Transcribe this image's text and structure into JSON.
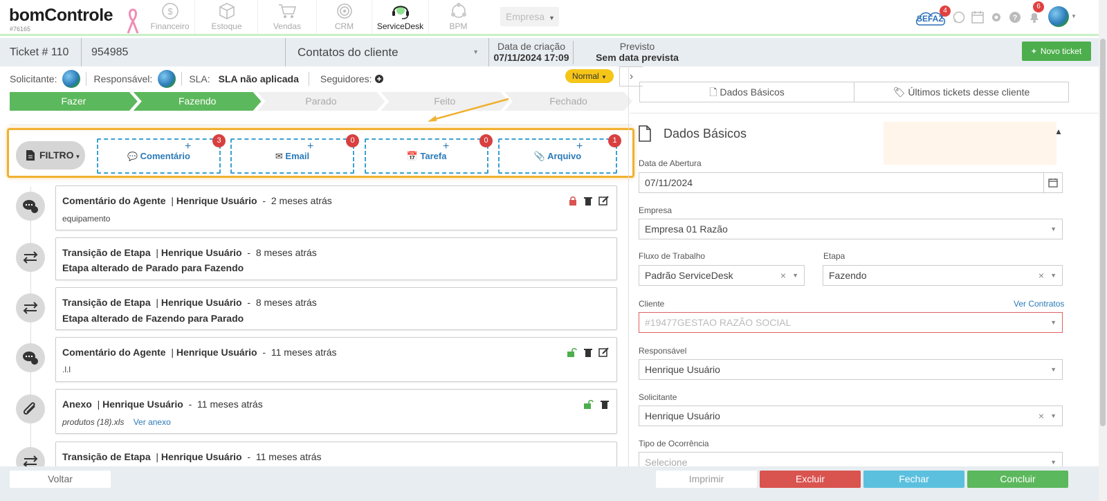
{
  "app": {
    "logo": "bomControle",
    "account_id": "#76165"
  },
  "nav": [
    {
      "label": "Financeiro",
      "icon": "dollar-icon",
      "active": false
    },
    {
      "label": "Estoque",
      "icon": "box-icon",
      "active": false
    },
    {
      "label": "Vendas",
      "icon": "cart-icon",
      "active": false
    },
    {
      "label": "CRM",
      "icon": "target-icon",
      "active": false
    },
    {
      "label": "ServiceDesk",
      "icon": "headset-icon",
      "active": true
    },
    {
      "label": "BPM",
      "icon": "network-icon",
      "active": false
    }
  ],
  "empresa_select": "Empresa",
  "topright": {
    "sefaz_label": "SEFAZ",
    "sefaz_count": "4",
    "notif_count": "6"
  },
  "ticket": {
    "number": "Ticket # 110",
    "code": "954985",
    "contacts_select": "Contatos do cliente",
    "created_label": "Data de criação",
    "created_value": "07/11/2024 17:09",
    "forecast_label": "Previsto",
    "forecast_value": "Sem data prevista",
    "new_ticket": "Novo ticket"
  },
  "info": {
    "requester_label": "Solicitante:",
    "responsible_label": "Responsável:",
    "sla_label": "SLA:",
    "sla_value": "SLA não aplicada",
    "followers_label": "Seguidores:",
    "priority": "Normal"
  },
  "stages": [
    {
      "label": "Fazer",
      "done": true
    },
    {
      "label": "Fazendo",
      "done": true
    },
    {
      "label": "Parado",
      "done": false
    },
    {
      "label": "Feito",
      "done": false
    },
    {
      "label": "Fechado",
      "done": false
    }
  ],
  "filter": {
    "label": "FILTRO",
    "actions": [
      {
        "label": "Comentário",
        "count": "3"
      },
      {
        "label": "Email",
        "count": "0"
      },
      {
        "label": "Tarefa",
        "count": "0"
      },
      {
        "label": "Arquivo",
        "count": "1"
      }
    ]
  },
  "timeline": [
    {
      "type": "Comentário do Agente",
      "user": "Henrique Usuário",
      "when": "2 meses atrás",
      "body": "equipamento",
      "bold_body": false
    },
    {
      "type": "Transição de Etapa",
      "user": "Henrique Usuário",
      "when": "8 meses atrás",
      "body": "Etapa alterado de Parado para Fazendo",
      "bold_body": true
    },
    {
      "type": "Transição de Etapa",
      "user": "Henrique Usuário",
      "when": "8 meses atrás",
      "body": "Etapa alterado de Fazendo para Parado",
      "bold_body": true
    },
    {
      "type": "Comentário do Agente",
      "user": "Henrique Usuário",
      "when": "11 meses atrás",
      "body": ".l.l",
      "bold_body": false
    },
    {
      "type": "Anexo",
      "user": "Henrique Usuário",
      "when": "11 meses atrás",
      "body": "produtos (18).xls",
      "link": "Ver anexo",
      "bold_body": false
    },
    {
      "type": "Transição de Etapa",
      "user": "Henrique Usuário",
      "when": "11 meses atrás",
      "body": "",
      "bold_body": false
    }
  ],
  "panel": {
    "tab_basic": "Dados Básicos",
    "tab_last": "Últimos tickets desse cliente",
    "section_title": "Dados Básicos",
    "fields": {
      "opening_label": "Data de Abertura",
      "opening_value": "07/11/2024",
      "empresa_label": "Empresa",
      "empresa_value": "Empresa 01 Razão",
      "flow_label": "Fluxo de Trabalho",
      "flow_value": "Padrão ServiceDesk",
      "stage_label": "Etapa",
      "stage_value": "Fazendo",
      "client_label": "Cliente",
      "client_link": "Ver Contratos",
      "client_placeholder": "#19477GESTAO RAZÃO SOCIAL",
      "responsible_label": "Responsável",
      "responsible_value": "Henrique Usuário",
      "requester_label": "Solicitante",
      "requester_value": "Henrique Usuário",
      "occurrence_label": "Tipo de Ocorrência",
      "occurrence_placeholder": "Selecione"
    }
  },
  "bottom": {
    "back": "Voltar",
    "print": "Imprimir",
    "delete": "Excluir",
    "close": "Fechar",
    "finish": "Concluir"
  },
  "colors": {
    "accent_green": "#5cb85c",
    "danger": "#d9534f",
    "info": "#5bc0de",
    "highlight": "#f0b030",
    "dashed_blue": "#3aa0d0"
  }
}
